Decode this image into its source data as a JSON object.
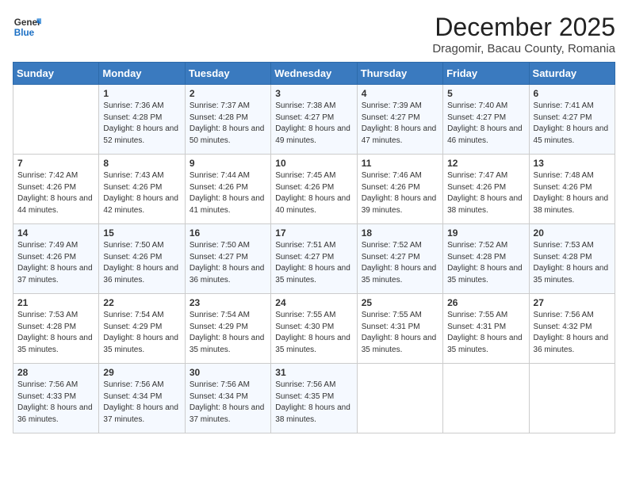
{
  "header": {
    "logo_line1": "General",
    "logo_line2": "Blue",
    "month": "December 2025",
    "location": "Dragomir, Bacau County, Romania"
  },
  "weekdays": [
    "Sunday",
    "Monday",
    "Tuesday",
    "Wednesday",
    "Thursday",
    "Friday",
    "Saturday"
  ],
  "weeks": [
    [
      {
        "day": "",
        "sunrise": "",
        "sunset": "",
        "daylight": ""
      },
      {
        "day": "1",
        "sunrise": "7:36 AM",
        "sunset": "4:28 PM",
        "daylight": "8 hours and 52 minutes."
      },
      {
        "day": "2",
        "sunrise": "7:37 AM",
        "sunset": "4:28 PM",
        "daylight": "8 hours and 50 minutes."
      },
      {
        "day": "3",
        "sunrise": "7:38 AM",
        "sunset": "4:27 PM",
        "daylight": "8 hours and 49 minutes."
      },
      {
        "day": "4",
        "sunrise": "7:39 AM",
        "sunset": "4:27 PM",
        "daylight": "8 hours and 47 minutes."
      },
      {
        "day": "5",
        "sunrise": "7:40 AM",
        "sunset": "4:27 PM",
        "daylight": "8 hours and 46 minutes."
      },
      {
        "day": "6",
        "sunrise": "7:41 AM",
        "sunset": "4:27 PM",
        "daylight": "8 hours and 45 minutes."
      }
    ],
    [
      {
        "day": "7",
        "sunrise": "7:42 AM",
        "sunset": "4:26 PM",
        "daylight": "8 hours and 44 minutes."
      },
      {
        "day": "8",
        "sunrise": "7:43 AM",
        "sunset": "4:26 PM",
        "daylight": "8 hours and 42 minutes."
      },
      {
        "day": "9",
        "sunrise": "7:44 AM",
        "sunset": "4:26 PM",
        "daylight": "8 hours and 41 minutes."
      },
      {
        "day": "10",
        "sunrise": "7:45 AM",
        "sunset": "4:26 PM",
        "daylight": "8 hours and 40 minutes."
      },
      {
        "day": "11",
        "sunrise": "7:46 AM",
        "sunset": "4:26 PM",
        "daylight": "8 hours and 39 minutes."
      },
      {
        "day": "12",
        "sunrise": "7:47 AM",
        "sunset": "4:26 PM",
        "daylight": "8 hours and 38 minutes."
      },
      {
        "day": "13",
        "sunrise": "7:48 AM",
        "sunset": "4:26 PM",
        "daylight": "8 hours and 38 minutes."
      }
    ],
    [
      {
        "day": "14",
        "sunrise": "7:49 AM",
        "sunset": "4:26 PM",
        "daylight": "8 hours and 37 minutes."
      },
      {
        "day": "15",
        "sunrise": "7:50 AM",
        "sunset": "4:26 PM",
        "daylight": "8 hours and 36 minutes."
      },
      {
        "day": "16",
        "sunrise": "7:50 AM",
        "sunset": "4:27 PM",
        "daylight": "8 hours and 36 minutes."
      },
      {
        "day": "17",
        "sunrise": "7:51 AM",
        "sunset": "4:27 PM",
        "daylight": "8 hours and 35 minutes."
      },
      {
        "day": "18",
        "sunrise": "7:52 AM",
        "sunset": "4:27 PM",
        "daylight": "8 hours and 35 minutes."
      },
      {
        "day": "19",
        "sunrise": "7:52 AM",
        "sunset": "4:28 PM",
        "daylight": "8 hours and 35 minutes."
      },
      {
        "day": "20",
        "sunrise": "7:53 AM",
        "sunset": "4:28 PM",
        "daylight": "8 hours and 35 minutes."
      }
    ],
    [
      {
        "day": "21",
        "sunrise": "7:53 AM",
        "sunset": "4:28 PM",
        "daylight": "8 hours and 35 minutes."
      },
      {
        "day": "22",
        "sunrise": "7:54 AM",
        "sunset": "4:29 PM",
        "daylight": "8 hours and 35 minutes."
      },
      {
        "day": "23",
        "sunrise": "7:54 AM",
        "sunset": "4:29 PM",
        "daylight": "8 hours and 35 minutes."
      },
      {
        "day": "24",
        "sunrise": "7:55 AM",
        "sunset": "4:30 PM",
        "daylight": "8 hours and 35 minutes."
      },
      {
        "day": "25",
        "sunrise": "7:55 AM",
        "sunset": "4:31 PM",
        "daylight": "8 hours and 35 minutes."
      },
      {
        "day": "26",
        "sunrise": "7:55 AM",
        "sunset": "4:31 PM",
        "daylight": "8 hours and 35 minutes."
      },
      {
        "day": "27",
        "sunrise": "7:56 AM",
        "sunset": "4:32 PM",
        "daylight": "8 hours and 36 minutes."
      }
    ],
    [
      {
        "day": "28",
        "sunrise": "7:56 AM",
        "sunset": "4:33 PM",
        "daylight": "8 hours and 36 minutes."
      },
      {
        "day": "29",
        "sunrise": "7:56 AM",
        "sunset": "4:34 PM",
        "daylight": "8 hours and 37 minutes."
      },
      {
        "day": "30",
        "sunrise": "7:56 AM",
        "sunset": "4:34 PM",
        "daylight": "8 hours and 37 minutes."
      },
      {
        "day": "31",
        "sunrise": "7:56 AM",
        "sunset": "4:35 PM",
        "daylight": "8 hours and 38 minutes."
      },
      {
        "day": "",
        "sunrise": "",
        "sunset": "",
        "daylight": ""
      },
      {
        "day": "",
        "sunrise": "",
        "sunset": "",
        "daylight": ""
      },
      {
        "day": "",
        "sunrise": "",
        "sunset": "",
        "daylight": ""
      }
    ]
  ]
}
